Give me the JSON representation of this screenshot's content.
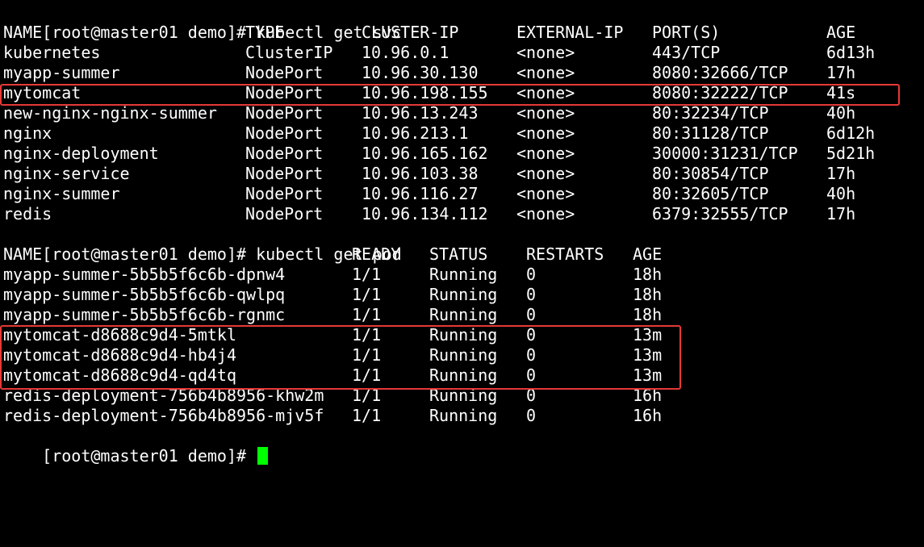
{
  "colors": {
    "background": "#000000",
    "text": "#ffffff",
    "cursor": "#00ff00",
    "highlight_box": "#e53935"
  },
  "commands": {
    "svc": "[root@master01 demo]# kubectl get svc",
    "pod": "[root@master01 demo]# kubectl get pod",
    "final_prompt": "[root@master01 demo]# "
  },
  "svc_table": {
    "headers": [
      "NAME",
      "TYPE",
      "CLUSTER-IP",
      "EXTERNAL-IP",
      "PORT(S)",
      "AGE"
    ],
    "rows": [
      [
        "kubernetes",
        "ClusterIP",
        "10.96.0.1",
        "<none>",
        "443/TCP",
        "6d13h"
      ],
      [
        "myapp-summer",
        "NodePort",
        "10.96.30.130",
        "<none>",
        "8080:32666/TCP",
        "17h"
      ],
      [
        "mytomcat",
        "NodePort",
        "10.96.198.155",
        "<none>",
        "8080:32222/TCP",
        "41s"
      ],
      [
        "new-nginx-nginx-summer",
        "NodePort",
        "10.96.13.243",
        "<none>",
        "80:32234/TCP",
        "40h"
      ],
      [
        "nginx",
        "NodePort",
        "10.96.213.1",
        "<none>",
        "80:31128/TCP",
        "6d12h"
      ],
      [
        "nginx-deployment",
        "NodePort",
        "10.96.165.162",
        "<none>",
        "30000:31231/TCP",
        "5d21h"
      ],
      [
        "nginx-service",
        "NodePort",
        "10.96.103.38",
        "<none>",
        "80:30854/TCP",
        "17h"
      ],
      [
        "nginx-summer",
        "NodePort",
        "10.96.116.27",
        "<none>",
        "80:32605/TCP",
        "40h"
      ],
      [
        "redis",
        "NodePort",
        "10.96.134.112",
        "<none>",
        "6379:32555/TCP",
        "17h"
      ]
    ]
  },
  "pod_table": {
    "headers": [
      "NAME",
      "READY",
      "STATUS",
      "RESTARTS",
      "AGE"
    ],
    "rows": [
      [
        "myapp-summer-5b5b5f6c6b-dpnw4",
        "1/1",
        "Running",
        "0",
        "18h"
      ],
      [
        "myapp-summer-5b5b5f6c6b-qwlpq",
        "1/1",
        "Running",
        "0",
        "18h"
      ],
      [
        "myapp-summer-5b5b5f6c6b-rgnmc",
        "1/1",
        "Running",
        "0",
        "18h"
      ],
      [
        "mytomcat-d8688c9d4-5mtkl",
        "1/1",
        "Running",
        "0",
        "13m"
      ],
      [
        "mytomcat-d8688c9d4-hb4j4",
        "1/1",
        "Running",
        "0",
        "13m"
      ],
      [
        "mytomcat-d8688c9d4-qd4tq",
        "1/1",
        "Running",
        "0",
        "13m"
      ],
      [
        "redis-deployment-756b4b8956-khw2m",
        "1/1",
        "Running",
        "0",
        "16h"
      ],
      [
        "redis-deployment-756b4b8956-mjv5f",
        "1/1",
        "Running",
        "0",
        "16h"
      ]
    ]
  }
}
